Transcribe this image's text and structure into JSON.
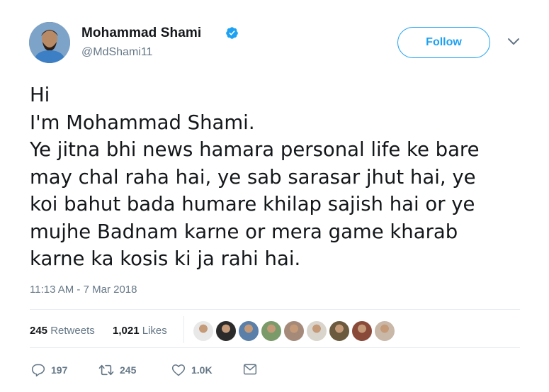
{
  "user": {
    "display_name": "Mohammad Shami",
    "handle": "@MdShami11",
    "verified": true
  },
  "follow_button": {
    "label": "Follow"
  },
  "tweet": {
    "text": "Hi\nI'm Mohammad Shami.\nYe jitna bhi news hamara personal life ke bare\nmay chal raha hai, ye sab sarasar jhut hai, ye\nkoi bahut bada humare khilap sajish hai or ye\nmujhe Badnam karne or mera game kharab\nkarne ka kosis ki ja rahi hai.",
    "timestamp": "11:13 AM - 7 Mar 2018"
  },
  "stats": {
    "retweets_count": "245",
    "retweets_label": "Retweets",
    "likes_count": "1,021",
    "likes_label": "Likes"
  },
  "likers": [
    {
      "name": "liker-avatar-1",
      "color": "#e8e8e8"
    },
    {
      "name": "liker-avatar-2",
      "color": "#2b2b2b"
    },
    {
      "name": "liker-avatar-3",
      "color": "#5a7fa8"
    },
    {
      "name": "liker-avatar-4",
      "color": "#7a9a6a"
    },
    {
      "name": "liker-avatar-5",
      "color": "#a58a7a"
    },
    {
      "name": "liker-avatar-6",
      "color": "#d9d4cc"
    },
    {
      "name": "liker-avatar-7",
      "color": "#6b5a3e"
    },
    {
      "name": "liker-avatar-8",
      "color": "#8a4a3a"
    },
    {
      "name": "liker-avatar-9",
      "color": "#c9b7a8"
    }
  ],
  "actions": {
    "reply_count": "197",
    "retweet_count": "245",
    "like_count": "1.0K"
  },
  "colors": {
    "accent": "#1da1f2",
    "text": "#14171a",
    "secondary": "#657786",
    "divider": "#e6ecf0"
  }
}
